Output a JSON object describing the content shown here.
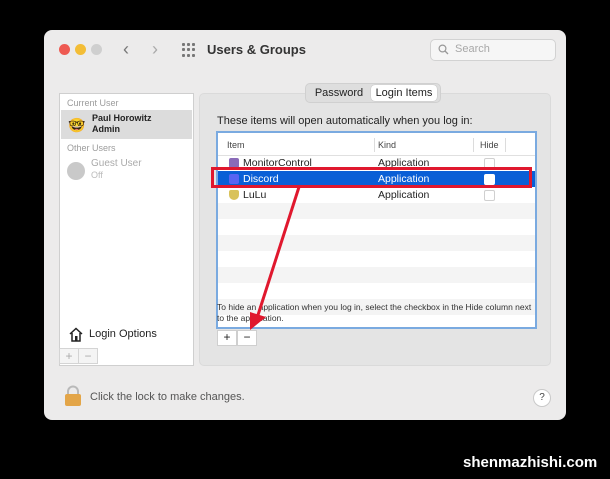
{
  "window": {
    "title": "Users & Groups",
    "search_placeholder": "Search"
  },
  "tabs": [
    {
      "label": "Password"
    },
    {
      "label": "Login Items",
      "active": true
    }
  ],
  "sidebar": {
    "current_header": "Current User",
    "current_user": {
      "name": "Paul Horowitz",
      "role": "Admin",
      "avatar": "emoji-glasses-face-icon"
    },
    "other_header": "Other Users",
    "guest": {
      "name": "Guest User",
      "status": "Off"
    },
    "login_options_label": "Login Options",
    "add_label": "+",
    "remove_label": "−"
  },
  "login_items": {
    "intro": "These items will open automatically when you log in:",
    "columns": [
      "Item",
      "Kind",
      "Hide"
    ],
    "rows": [
      {
        "name": "MonitorControl",
        "kind": "Application",
        "hide": false,
        "selected": false,
        "icon": "monitorcontrol-icon"
      },
      {
        "name": "Discord",
        "kind": "Application",
        "hide": false,
        "selected": true,
        "icon": "discord-icon"
      },
      {
        "name": "LuLu",
        "kind": "Application",
        "hide": false,
        "selected": false,
        "icon": "lulu-icon"
      }
    ],
    "hint": "To hide an application when you log in, select the checkbox in the Hide column next to the application.",
    "add_label": "+",
    "remove_label": "−"
  },
  "footer": {
    "lock_text": "Click the lock to make changes.",
    "help_label": "?"
  },
  "watermark": "shenmazhishi.com",
  "colors": {
    "selection": "#0a5fd6",
    "annotation_red": "#e0182e",
    "window_bg": "#ecebeb"
  }
}
